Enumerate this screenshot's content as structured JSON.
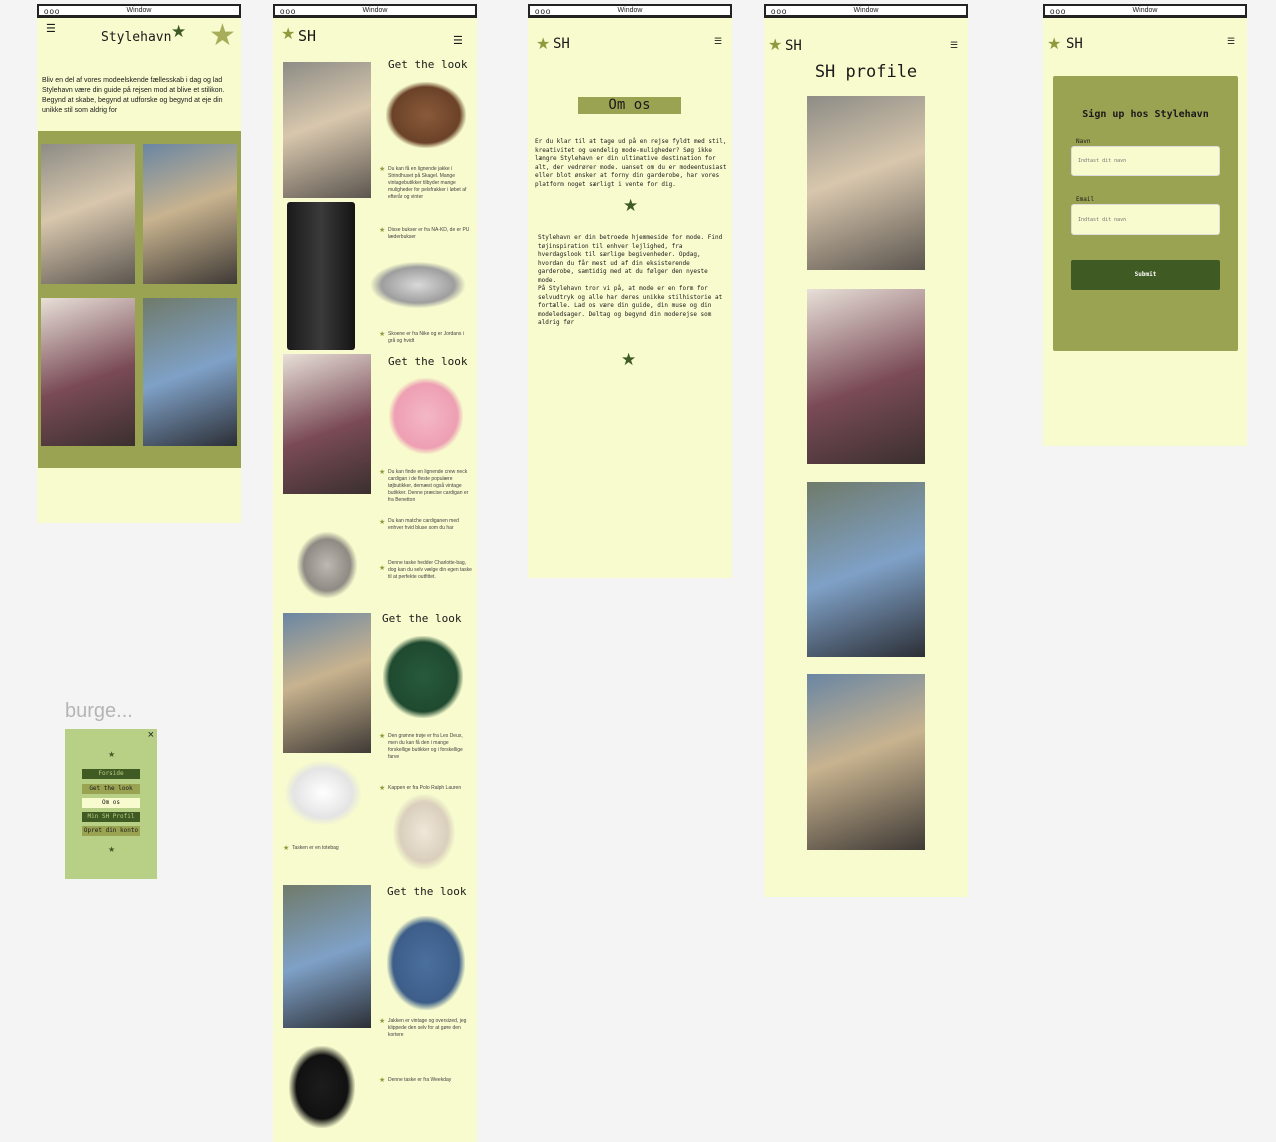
{
  "window_label": "Window",
  "window_dots": "ooo",
  "colors": {
    "cream": "#f7fbcd",
    "olive": "#9aa352",
    "dark_green": "#3f5a23",
    "star": "#8f9a3f",
    "burger_bg": "#b8cf86"
  },
  "home": {
    "title": "Stylehavn",
    "intro": "Bliv en del af vores modeelskende fællesskab i dag og lad Stylehavn være din guide på rejsen mod at blive et stilikon. Begynd at skabe, begynd at udforske og begynd at eje din unikke stil som aldrig for"
  },
  "brand_short": "SH",
  "get_the_look": {
    "heading": "Get the look",
    "captions": [
      "Du kan få en lignende jakke i Strindhuset på Skagel. Mange vintagebutikker tilbyder mange muligheder for pelsfrakker i løbet af efterår og vinter",
      "Disse bukser er fra NA-KD, de er PU læderbukser",
      "Skoene er fra Nike og er Jordans i grå og hvidt",
      "Du kan finde en lignende crew neck cardigan i de fleste populære tøjbutikker, dernæst også vintage butikker. Denne præcise cardigan er fra Benetton",
      "Du kan matche cardiganen med enhver hvid bluse som du har",
      "Denne taske hedder Charlotte-bag, dog kan du selv vælge din egen taske til at perfekte outfittet.",
      "Den grønne trøje er fra Les Deux, men du kan få den i mange forskellige butikker og i forskellige farve",
      "Kappen er fra Polo Ralph Lauren",
      "Tasken er en totebag",
      "Jakken er vintage og oversized, jeg klippede den selv for at gøre den kortere",
      "Denne taske er fra Weekday"
    ]
  },
  "om_os": {
    "heading": "Om os",
    "para1": "Er du klar til at tage ud på en rejse fyldt med stil, kreativitet og uendelig mode-muligheder? Søg ikke længre Stylehavn er din ultimative destination for alt, der vedrører mode. uanset om du er modeentusiast eller blot ønsker at forny din garderobe, har vores platform noget særligt i vente for dig.",
    "para2": "Stylehavn er din betroede hjemmeside for mode. Find tøjinspiration til enhver lejlighed, fra hverdagslook til særlige begivenheder. Opdag, hvordan du får mest ud af din eksisterende garderobe, samtidig med at du følger den nyeste mode.",
    "para3": "På Stylehavn tror vi på, at mode er en form for selvudtryk og alle har deres unikke stilhistorie at fortælle. Lad os være din guide, din muse og din modeledsager. Deltag og begynd din moderejse som aldrig før"
  },
  "profile": {
    "heading": "SH profile"
  },
  "signup": {
    "heading": "Sign up hos Stylehavn",
    "name_label": "Navn",
    "name_placeholder": "Indtast dit navn",
    "email_label": "Email",
    "email_placeholder": "Indtast dit navn",
    "submit_label": "Submit"
  },
  "burger": {
    "label": "burge...",
    "close": "×",
    "items": [
      "Forside",
      "Get the look",
      "Om os",
      "Min SH Profil",
      "Opret din konto"
    ]
  }
}
